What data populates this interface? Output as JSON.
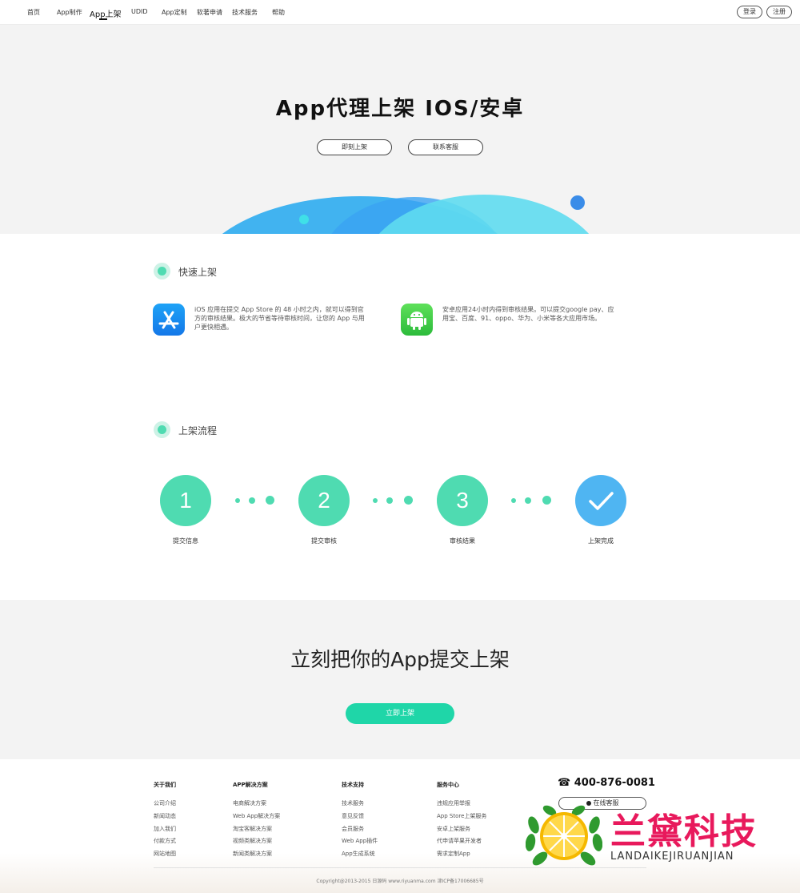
{
  "nav": {
    "items": [
      "首页",
      "App制作",
      "App上架",
      "UDID",
      "App定制",
      "软著申请",
      "技术服务",
      "帮助"
    ],
    "login": "登录",
    "register": "注册"
  },
  "hero": {
    "title": "App代理上架 IOS/安卓",
    "btn_publish": "即刻上架",
    "btn_contact": "联系客服"
  },
  "quick": {
    "title": "快速上架",
    "ios_desc": "iOS 应用在提交 App Store 的 48 小时之内，就可以得到官方的审核结果。极大的节省等待审核时间，让您的 App 与用户更快相遇。",
    "android_desc": "安卓应用24小时内得到审核结果。可以提交google pay、应用宝、百度、91、oppo、华为、小米等各大应用市场。",
    "ios_icon": "app-store-icon",
    "android_icon": "android-icon"
  },
  "process": {
    "title": "上架流程",
    "steps": [
      {
        "num": "1",
        "label": "提交信息"
      },
      {
        "num": "2",
        "label": "提交审核"
      },
      {
        "num": "3",
        "label": "审核结果"
      },
      {
        "num": "✓",
        "label": "上架完成"
      }
    ]
  },
  "cta": {
    "title": "立刻把你的App提交上架",
    "button": "立即上架"
  },
  "footer": {
    "columns": [
      {
        "head": "关于我们",
        "links": [
          "公司介绍",
          "新闻动态",
          "加入我们",
          "付款方式",
          "网站地图"
        ]
      },
      {
        "head": "APP解决方案",
        "links": [
          "电商解决方案",
          "Web App解决方案",
          "淘宝客解决方案",
          "视频类解决方案",
          "新闻类解决方案"
        ]
      },
      {
        "head": "技术支持",
        "links": [
          "技术服务",
          "意见反馈",
          "会员服务",
          "Web App插件",
          "App生成系统"
        ]
      },
      {
        "head": "服务中心",
        "links": [
          "违规应用举报",
          "App Store上架服务",
          "安卓上架服务",
          "代申请苹果开发者",
          "需求定制App"
        ]
      }
    ],
    "phone_icon": "☎",
    "phone": "400-876-0081",
    "online_service": "在线客服",
    "copyright": "Copyright@2013-2015 日源码 www.riyuanma.com 津ICP备17006685号"
  },
  "watermark": {
    "name": "兰黛科技",
    "sub": "LANDAIKEJIRUANJIAN"
  },
  "colors": {
    "accent": "#1fd6a8",
    "step": "#4fdbb1",
    "done": "#4fb5f2",
    "brand_red": "#e8195c"
  }
}
